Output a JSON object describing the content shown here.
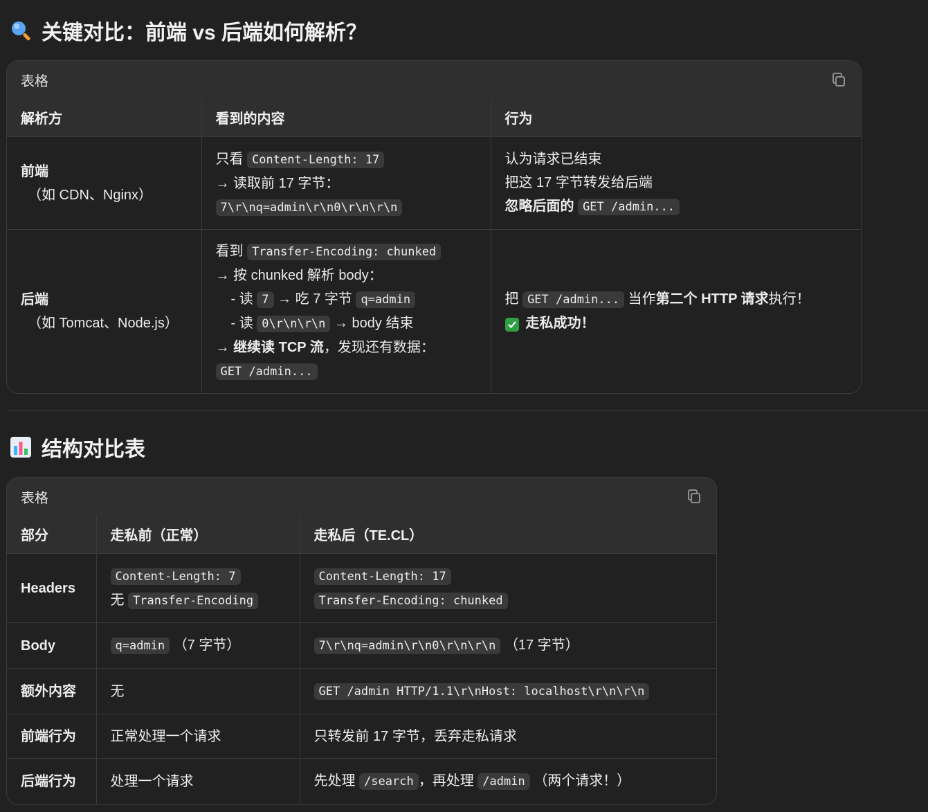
{
  "section1": {
    "title": "关键对比：前端 vs 后端如何解析？",
    "card_label": "表格",
    "headers": [
      "解析方",
      "看到的内容",
      "行为"
    ],
    "row1": {
      "party": "前端",
      "party_note": "（如 CDN、Nginx）",
      "c1_l1_text": "只看 ",
      "c1_l1_code": "Content-Length: 17",
      "c1_l2_text": "→ 读取前 17 字节：",
      "c1_l3_code": "7\\r\\nq=admin\\r\\n0\\r\\n\\r\\n",
      "c2_l1": "认为请求已结束",
      "c2_l2": "把这 17 字节转发给后端",
      "c2_l3_bold": "忽略后面的",
      "c2_l3_code": "GET /admin..."
    },
    "row2": {
      "party": "后端",
      "party_note": "（如 Tomcat、Node.js）",
      "c1_l1_text": "看到 ",
      "c1_l1_code": "Transfer-Encoding: chunked",
      "c1_l2_text": "→ 按 chunked 解析 body：",
      "c1_l3_a": "- 读 ",
      "c1_l3_code1": "7",
      "c1_l3_b": " → 吃 7 字节 ",
      "c1_l3_code2": "q=admin",
      "c1_l4_a": "- 读 ",
      "c1_l4_code": "0\\r\\n\\r\\n",
      "c1_l4_b": " → body 结束",
      "c1_l5_arrow": "→ ",
      "c1_l5_bold": "继续读 TCP 流",
      "c1_l5_rest": "，发现还有数据：",
      "c1_l6_code": "GET /admin...",
      "c2_l1_a": "把 ",
      "c2_l1_code": "GET /admin...",
      "c2_l1_b": " 当作",
      "c2_l1_bold": "第二个 HTTP 请求",
      "c2_l1_c": "执行！",
      "c2_l2_bold": "走私成功！"
    }
  },
  "section2": {
    "title": "结构对比表",
    "card_label": "表格",
    "headers": [
      "部分",
      "走私前（正常）",
      "走私后（TE.CL）"
    ],
    "rows": {
      "headers_row": {
        "label": "Headers",
        "before_code": "Content-Length: 7",
        "before_l2_text": "无 ",
        "before_l2_code": "Transfer-Encoding",
        "after_code1": "Content-Length: 17",
        "after_code2": "Transfer-Encoding: chunked"
      },
      "body_row": {
        "label": "Body",
        "before_code": "q=admin",
        "before_note": "（7 字节）",
        "after_code": "7\\r\\nq=admin\\r\\n0\\r\\n\\r\\n",
        "after_note": "（17 字节）"
      },
      "extra_row": {
        "label": "额外内容",
        "before": "无",
        "after_code": "GET /admin HTTP/1.1\\r\\nHost: localhost\\r\\n\\r\\n"
      },
      "frontend_row": {
        "label": "前端行为",
        "before": "正常处理一个请求",
        "after": "只转发前 17 字节，丢弃走私请求"
      },
      "backend_row": {
        "label": "后端行为",
        "before": "处理一个请求",
        "after_a": "先处理 ",
        "after_code1": "/search",
        "after_b": "，再处理 ",
        "after_code2": "/admin",
        "after_c": "（两个请求！）"
      }
    }
  }
}
